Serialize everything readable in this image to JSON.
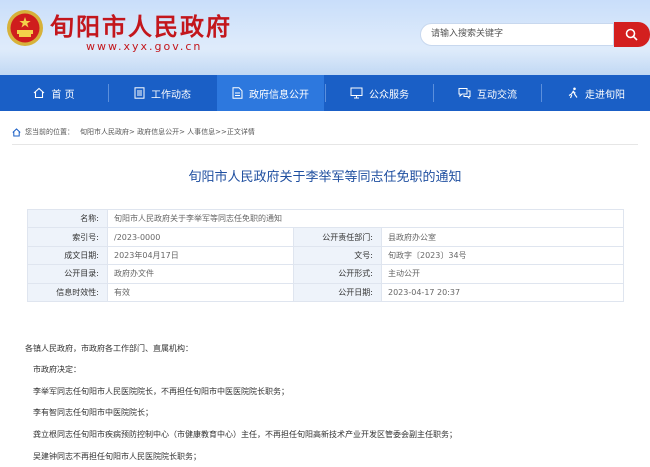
{
  "header": {
    "site_name": "旬阳市人民政府",
    "site_url": "www.xyx.gov.cn",
    "search_placeholder": "请输入搜索关键字"
  },
  "nav": {
    "items": [
      {
        "label": "首 页",
        "icon": "home-icon"
      },
      {
        "label": "工作动态",
        "icon": "document-list-icon"
      },
      {
        "label": "政府信息公开",
        "icon": "file-info-icon"
      },
      {
        "label": "公众服务",
        "icon": "monitor-icon"
      },
      {
        "label": "互动交流",
        "icon": "chat-icon"
      },
      {
        "label": "走进旬阳",
        "icon": "walker-icon"
      }
    ]
  },
  "breadcrumb": {
    "prefix": "您当前的位置：",
    "path": "旬阳市人民政府> 政府信息公开> 人事信息>>正文详情"
  },
  "document": {
    "title": "旬阳市人民政府关于李举军等同志任免职的通知",
    "meta": {
      "name_label": "名称:",
      "name_value": "旬阳市人民政府关于李举军等同志任免职的通知",
      "index_label": "索引号:",
      "index_value": "/2023-0000",
      "dept_label": "公开责任部门:",
      "dept_value": "县政府办公室",
      "date_label": "成文日期:",
      "date_value": "2023年04月17日",
      "docno_label": "文号:",
      "docno_value": "旬政字〔2023〕34号",
      "catalog_label": "公开目录:",
      "catalog_value": "政府办文件",
      "form_label": "公开形式:",
      "form_value": "主动公开",
      "validity_label": "信息时效性:",
      "validity_value": "有效",
      "pubdate_label": "公开日期:",
      "pubdate_value": "2023-04-17 20:37"
    },
    "paragraphs": [
      "各镇人民政府，市政府各工作部门、直属机构：",
      "市政府决定：",
      "李举军同志任旬阳市人民医院院长，不再担任旬阳市中医医院院长职务；",
      "李有智同志任旬阳市中医院院长；",
      "龚立根同志任旬阳市疾病预防控制中心（市健康教育中心）主任，不再担任旬阳高新技术产业开发区管委会副主任职务；",
      "吴建钟同志不再担任旬阳市人民医院院长职务；"
    ]
  },
  "colors": {
    "brand_red": "#c3161c",
    "nav_blue": "#1a5fc6",
    "title_blue": "#1f4fa0"
  }
}
